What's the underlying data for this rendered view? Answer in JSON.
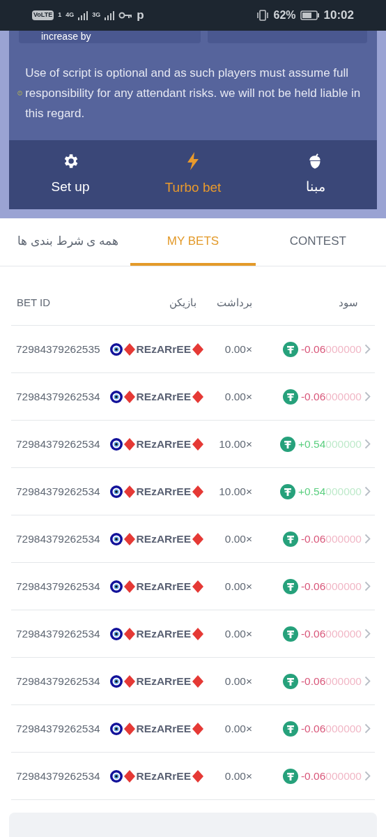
{
  "status_bar": {
    "volte": "VoLTE",
    "sim": "1",
    "net1": "4G",
    "net2": "3G",
    "extra": "p",
    "battery": "62%",
    "time": "10:02"
  },
  "script_panel": {
    "field_label": "increase by",
    "notice": "Use of script is optional and as such players must assume full responsibility for any attendant risks. we will not be held liable in this regard."
  },
  "nav": [
    {
      "label": "Set up",
      "kind": "gear",
      "selected": false
    },
    {
      "label": "Turbo bet",
      "kind": "bolt",
      "selected": true
    },
    {
      "label": "مبنا",
      "kind": "acorn",
      "selected": false
    }
  ],
  "tabs": [
    {
      "label": "همه ی شرط بندی ها",
      "selected": false
    },
    {
      "label": "MY BETS",
      "selected": true
    },
    {
      "label": "CONTEST",
      "selected": false
    }
  ],
  "table": {
    "header": {
      "bet_id": "BET ID",
      "player": "بازیکن",
      "payout": "برداشت",
      "profit": "سود"
    },
    "rows": [
      {
        "bet_id": "72984379262535",
        "player": "REzARrEE",
        "payout": "0.00×",
        "profit": "-0.06",
        "profit_tail": "000000",
        "kind": "loss"
      },
      {
        "bet_id": "72984379262534",
        "player": "REzARrEE",
        "payout": "0.00×",
        "profit": "-0.06",
        "profit_tail": "000000",
        "kind": "loss"
      },
      {
        "bet_id": "72984379262534",
        "player": "REzARrEE",
        "payout": "10.00×",
        "profit": "+0.54",
        "profit_tail": "000000",
        "kind": "win"
      },
      {
        "bet_id": "72984379262534",
        "player": "REzARrEE",
        "payout": "10.00×",
        "profit": "+0.54",
        "profit_tail": "000000",
        "kind": "win"
      },
      {
        "bet_id": "72984379262534",
        "player": "REzARrEE",
        "payout": "0.00×",
        "profit": "-0.06",
        "profit_tail": "000000",
        "kind": "loss"
      },
      {
        "bet_id": "72984379262534",
        "player": "REzARrEE",
        "payout": "0.00×",
        "profit": "-0.06",
        "profit_tail": "000000",
        "kind": "loss"
      },
      {
        "bet_id": "72984379262534",
        "player": "REzARrEE",
        "payout": "0.00×",
        "profit": "-0.06",
        "profit_tail": "000000",
        "kind": "loss"
      },
      {
        "bet_id": "72984379262534",
        "player": "REzARrEE",
        "payout": "0.00×",
        "profit": "-0.06",
        "profit_tail": "000000",
        "kind": "loss"
      },
      {
        "bet_id": "72984379262534",
        "player": "REzARrEE",
        "payout": "0.00×",
        "profit": "-0.06",
        "profit_tail": "000000",
        "kind": "loss"
      },
      {
        "bet_id": "72984379262534",
        "player": "REzARrEE",
        "payout": "0.00×",
        "profit": "-0.06",
        "profit_tail": "000000",
        "kind": "loss"
      }
    ]
  }
}
